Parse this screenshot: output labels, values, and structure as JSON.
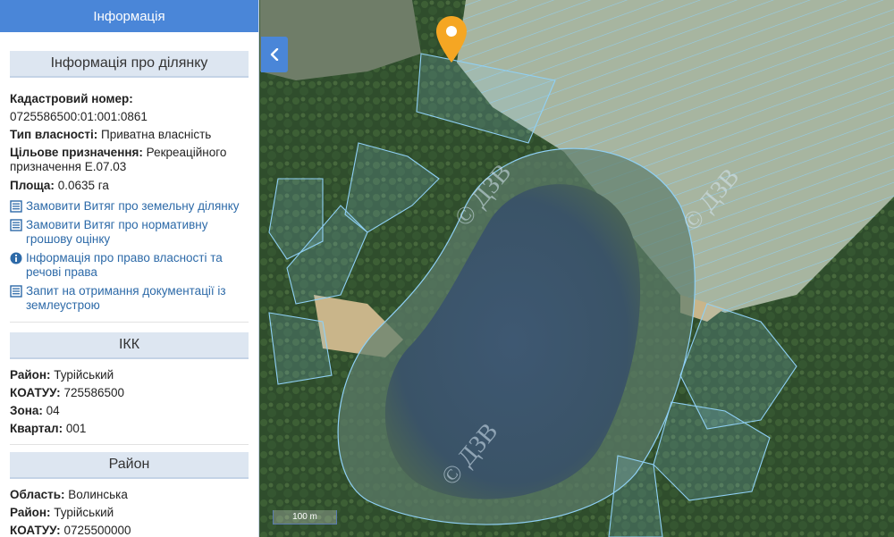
{
  "panel": {
    "header": "Інформація",
    "parcel": {
      "title": "Інформація про ділянку",
      "cadastral_label": "Кадастровий номер:",
      "cadastral_value": "0725586500:01:001:0861",
      "ownership_label": "Тип власності:",
      "ownership_value": "Приватна власність",
      "purpose_label": "Цільове призначення:",
      "purpose_value": "Рекреаційного призначення Е.07.03",
      "area_label": "Площа:",
      "area_value": "0.0635 га",
      "links": [
        {
          "icon": "document-list-icon",
          "text": "Замовити Витяг про земельну ділянку"
        },
        {
          "icon": "document-list-icon",
          "text": "Замовити Витяг про нормативну грошову оцінку"
        },
        {
          "icon": "info-circle-icon",
          "text": "Інформація про право власності та речові права"
        },
        {
          "icon": "document-list-icon",
          "text": "Запит на отримання документації із землеустрою"
        }
      ]
    },
    "ikk": {
      "title": "ІКК",
      "district_label": "Район:",
      "district_value": "Турійський",
      "koatuu_label": "КОАТУУ:",
      "koatuu_value": "725586500",
      "zone_label": "Зона:",
      "zone_value": "04",
      "quarter_label": "Квартал:",
      "quarter_value": "001"
    },
    "district": {
      "title": "Район",
      "region_label": "Область:",
      "region_value": "Волинська",
      "district_label": "Район:",
      "district_value": "Турійський",
      "koatuu_label": "КОАТУУ:",
      "koatuu_value": "0725500000"
    }
  },
  "map": {
    "watermark": "© ДЗВ",
    "scale_label": "100 m",
    "marker_color": "#f5a623",
    "parcel_color": "#8fd0f5"
  }
}
